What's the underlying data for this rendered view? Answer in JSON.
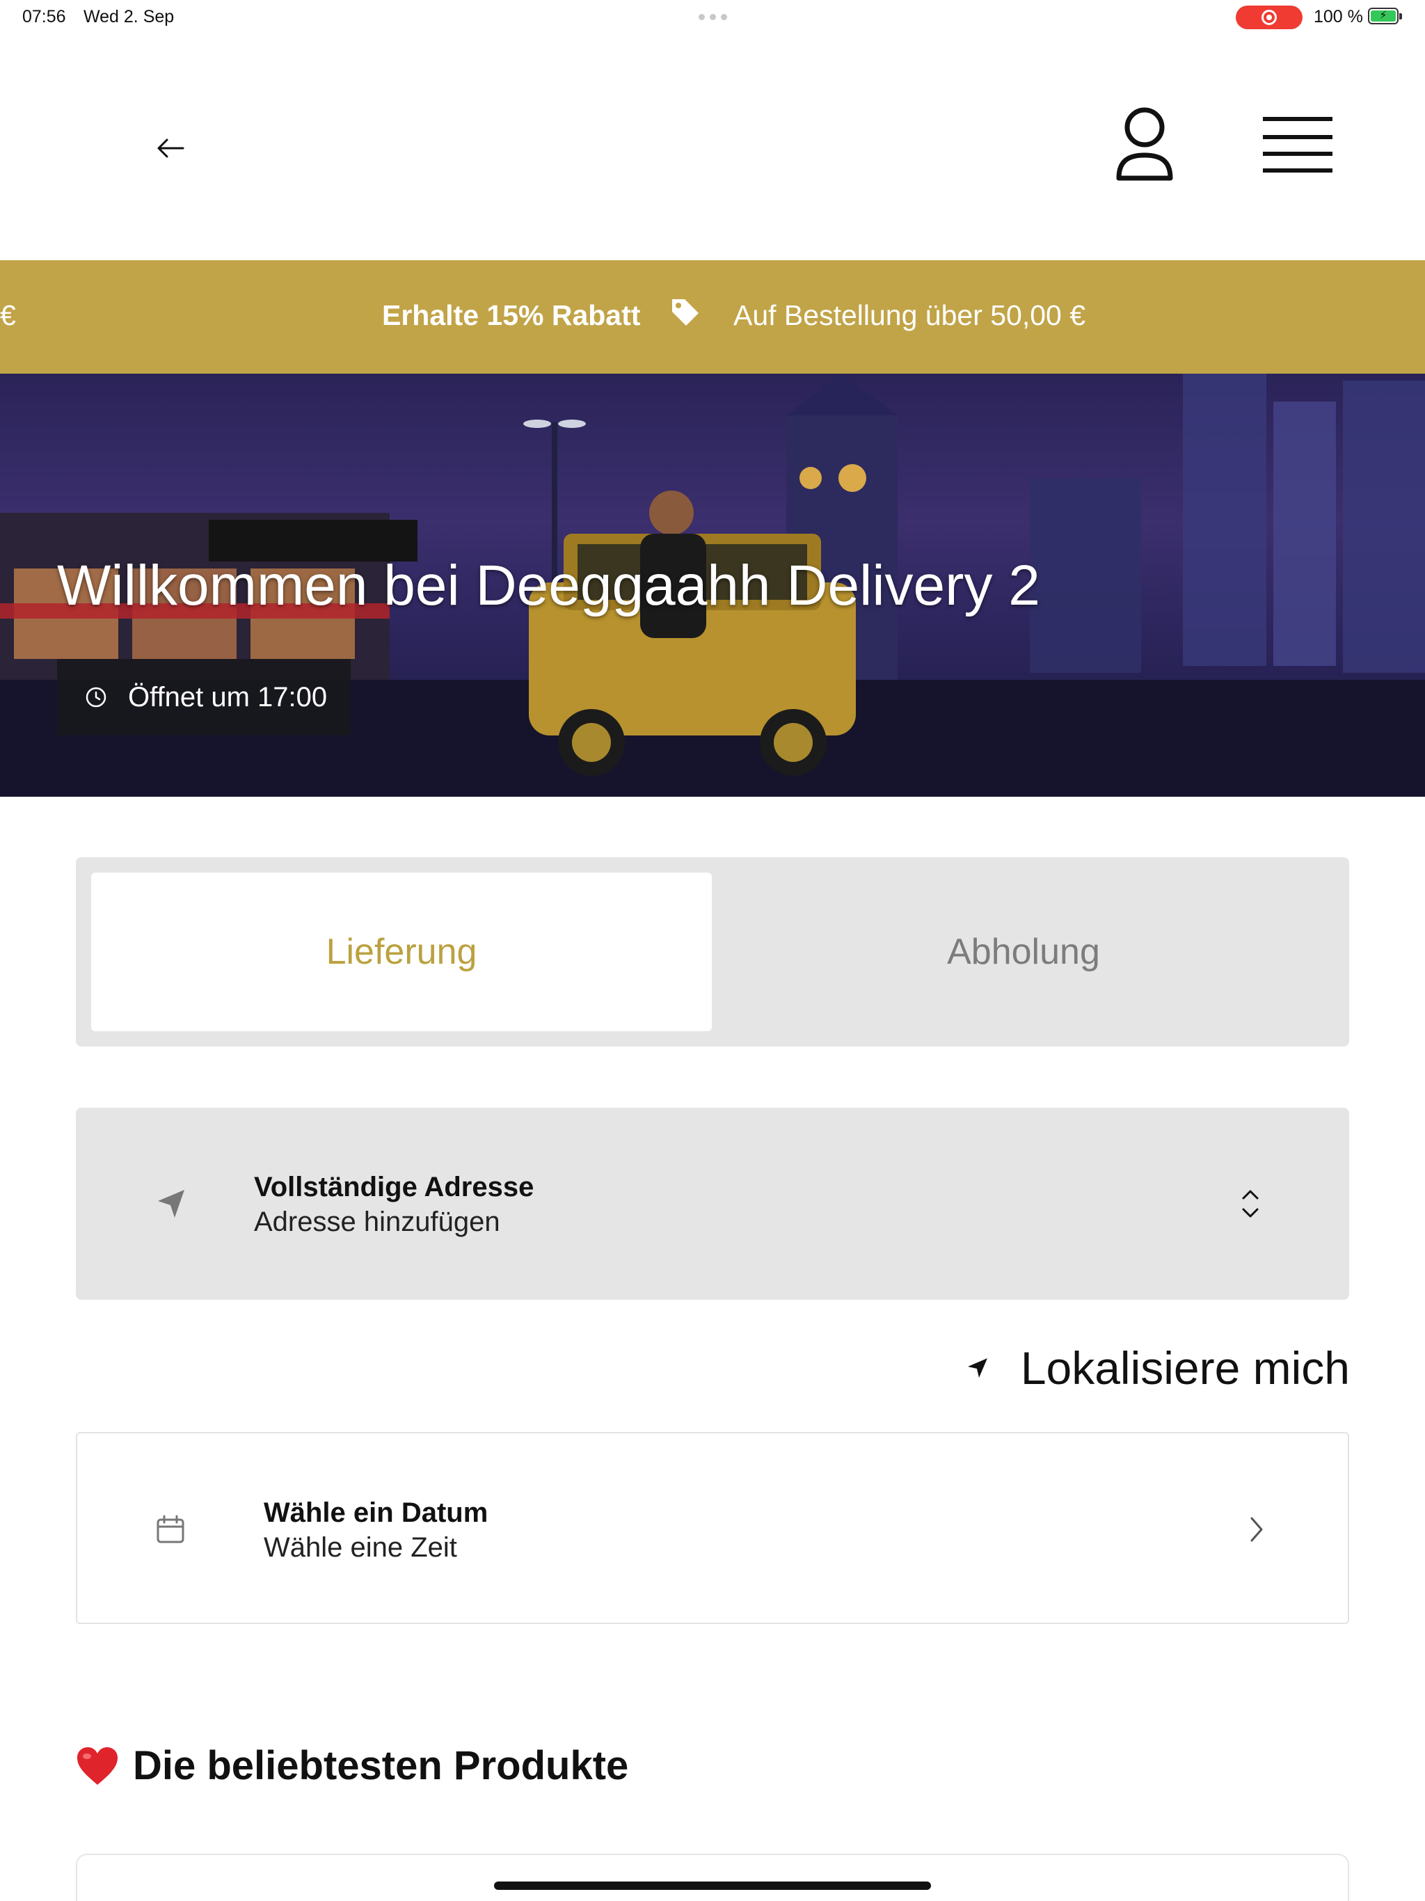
{
  "status_bar": {
    "time": "07:56",
    "date": "Wed 2. Sep",
    "battery_percent": "100 %",
    "battery_level": 1.0
  },
  "header": {
    "back_icon": "arrow-left-icon",
    "profile_icon": "user-icon",
    "menu_icon": "hamburger-menu-icon"
  },
  "promo": {
    "edge_text": "€",
    "title": "Erhalte 15% Rabatt",
    "icon": "tag-icon",
    "description": "Auf Bestellung über 50,00 €",
    "background_color": "#c1a448"
  },
  "hero": {
    "welcome_title": "Willkommen bei Deeggaahh Delivery 2",
    "opening_text": "Öffnet um 17:00",
    "opening_icon": "clock-icon"
  },
  "order_mode": {
    "options": [
      {
        "label": "Lieferung",
        "active": true
      },
      {
        "label": "Abholung",
        "active": false
      }
    ],
    "accent_color": "#bba140"
  },
  "address": {
    "icon": "navigation-arrow-icon",
    "label": "Vollständige Adresse",
    "placeholder": "Adresse hinzufügen",
    "expand_icon": "chevron-up-down-icon"
  },
  "locate": {
    "label": "Lokalisiere mich",
    "icon": "location-arrow-icon"
  },
  "schedule": {
    "icon": "calendar-icon",
    "label": "Wähle ein Datum",
    "sub": "Wähle eine Zeit",
    "chevron_icon": "chevron-right-icon"
  },
  "popular": {
    "icon": "heart-icon",
    "title": "Die beliebtesten Produkte"
  }
}
